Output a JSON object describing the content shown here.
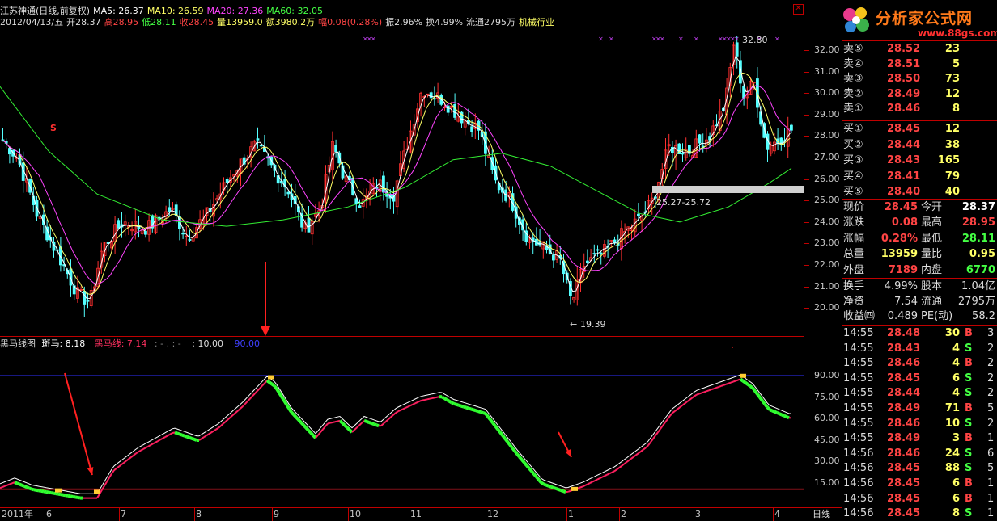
{
  "header": {
    "line1": [
      {
        "text": "江苏神通(日线,前复权)",
        "color": "#dddddd"
      },
      {
        "text": "MA5: 26.37",
        "color": "#ffffff"
      },
      {
        "text": "MA10: 26.59",
        "color": "#ffff66"
      },
      {
        "text": "MA20: 27.36",
        "color": "#ff44ff"
      },
      {
        "text": "MA60: 32.05",
        "color": "#44ff44"
      }
    ],
    "line2": [
      {
        "text": "2012/04/13/五",
        "color": "#dddddd"
      },
      {
        "text": "开28.37",
        "color": "#dddddd"
      },
      {
        "text": "高28.95",
        "color": "#ff4444"
      },
      {
        "text": "低28.11",
        "color": "#44ff44"
      },
      {
        "text": "收28.45",
        "color": "#ff4444"
      },
      {
        "text": "量13959.0",
        "color": "#ffff66"
      },
      {
        "text": "额3980.2万",
        "color": "#ffff66"
      },
      {
        "text": "幅0.08(0.28%)",
        "color": "#ff4444"
      },
      {
        "text": "振2.96%",
        "color": "#dddddd"
      },
      {
        "text": "换4.99%",
        "color": "#dddddd"
      },
      {
        "text": "流通2795万",
        "color": "#dddddd"
      },
      {
        "text": "机械行业",
        "color": "#ffff66"
      }
    ]
  },
  "logo": {
    "name": "分析家公式网",
    "url": "www.88gs.com"
  },
  "price_axis": [
    "32.00",
    "31.00",
    "30.00",
    "29.00",
    "28.00",
    "27.00",
    "26.00",
    "25.00",
    "24.00",
    "23.00",
    "22.00",
    "21.00",
    "20.00"
  ],
  "annotations": {
    "high": "32.80",
    "low": "19.39",
    "range": "25.27-25.72",
    "s_marker": "S"
  },
  "indicator": {
    "title": "黑马线图",
    "zebra": "斑马: 8.18",
    "black_horse": "黑马线: 7.14",
    "dash": ": - . : -",
    "v10": ": 10.00",
    "v90": "90.00",
    "axis": [
      "90.00",
      "75.00",
      "60.00",
      "45.00",
      "30.00",
      "15.00"
    ]
  },
  "time_axis": [
    "2011年",
    "6",
    "7",
    "8",
    "9",
    "10",
    "11",
    "12",
    "1",
    "2",
    "3",
    "4"
  ],
  "period": "日线",
  "orderbook": {
    "sell": [
      {
        "label": "卖⑤",
        "price": "28.52",
        "vol": "23"
      },
      {
        "label": "卖④",
        "price": "28.51",
        "vol": "5"
      },
      {
        "label": "卖③",
        "price": "28.50",
        "vol": "73"
      },
      {
        "label": "卖②",
        "price": "28.49",
        "vol": "12"
      },
      {
        "label": "卖①",
        "price": "28.46",
        "vol": "8"
      }
    ],
    "buy": [
      {
        "label": "买①",
        "price": "28.45",
        "vol": "12"
      },
      {
        "label": "买②",
        "price": "28.44",
        "vol": "38"
      },
      {
        "label": "买③",
        "price": "28.43",
        "vol": "165"
      },
      {
        "label": "买④",
        "price": "28.41",
        "vol": "79"
      },
      {
        "label": "买⑤",
        "price": "28.40",
        "vol": "40"
      }
    ]
  },
  "quote": [
    {
      "l1": "现价",
      "v1": "28.45",
      "c1": "#ff4444",
      "l2": "今开",
      "v2": "28.37",
      "c2": "#ffffff"
    },
    {
      "l1": "涨跌",
      "v1": "0.08",
      "c1": "#ff4444",
      "l2": "最高",
      "v2": "28.95",
      "c2": "#ff4444"
    },
    {
      "l1": "涨幅",
      "v1": "0.28%",
      "c1": "#ff4444",
      "l2": "最低",
      "v2": "28.11",
      "c2": "#44ff44"
    },
    {
      "l1": "总量",
      "v1": "13959",
      "c1": "#ffff66",
      "l2": "量比",
      "v2": "0.95",
      "c2": "#ffff66"
    },
    {
      "l1": "外盘",
      "v1": "7189",
      "c1": "#ff4444",
      "l2": "内盘",
      "v2": "6770",
      "c2": "#44ff44"
    }
  ],
  "stats": [
    {
      "l1": "换手",
      "v1": "4.99%",
      "l2": "股本",
      "v2": "1.04亿"
    },
    {
      "l1": "净资",
      "v1": "7.54",
      "l2": "流通",
      "v2": "2795万"
    },
    {
      "l1": "收益㈣",
      "v1": "0.489",
      "l2": "PE(动)",
      "v2": "58.2"
    }
  ],
  "ticks": [
    {
      "t": "14:55",
      "p": "28.48",
      "v": "30",
      "d": "B",
      "n": "3"
    },
    {
      "t": "14:55",
      "p": "28.43",
      "v": "4",
      "d": "S",
      "n": "2"
    },
    {
      "t": "14:55",
      "p": "28.46",
      "v": "4",
      "d": "B",
      "n": "2"
    },
    {
      "t": "14:55",
      "p": "28.45",
      "v": "6",
      "d": "S",
      "n": "2"
    },
    {
      "t": "14:55",
      "p": "28.44",
      "v": "4",
      "d": "S",
      "n": "2"
    },
    {
      "t": "14:55",
      "p": "28.49",
      "v": "71",
      "d": "B",
      "n": "5"
    },
    {
      "t": "14:55",
      "p": "28.46",
      "v": "10",
      "d": "S",
      "n": "2"
    },
    {
      "t": "14:55",
      "p": "28.49",
      "v": "3",
      "d": "B",
      "n": "1"
    },
    {
      "t": "14:56",
      "p": "28.46",
      "v": "24",
      "d": "S",
      "n": "6"
    },
    {
      "t": "14:56",
      "p": "28.45",
      "v": "88",
      "d": "S",
      "n": "5"
    },
    {
      "t": "14:56",
      "p": "28.45",
      "v": "6",
      "d": "B",
      "n": "1"
    },
    {
      "t": "14:56",
      "p": "28.45",
      "v": "6",
      "d": "B",
      "n": "1"
    },
    {
      "t": "14:56",
      "p": "28.45",
      "v": "8",
      "d": "S",
      "n": "1"
    }
  ]
}
